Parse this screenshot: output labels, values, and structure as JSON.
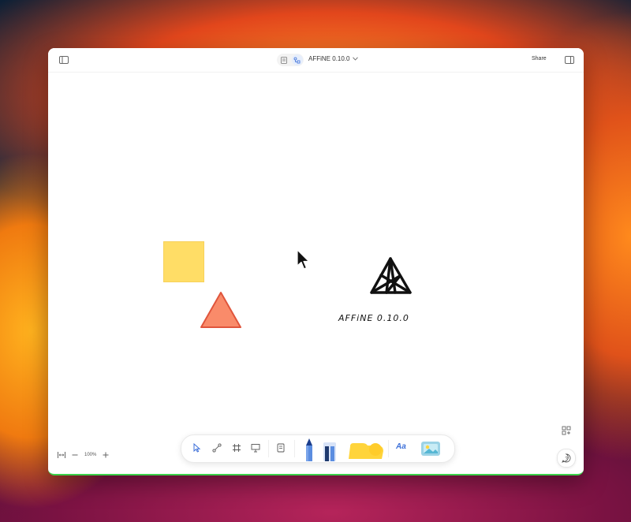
{
  "topbar": {
    "sidebar_toggle_icon": "sidebar-icon",
    "mode_page_icon": "page-mode-icon",
    "mode_edgeless_icon": "edgeless-mode-icon",
    "doc_title": "AFFiNE 0.10.0",
    "share_label": "Share",
    "right_panel_icon": "right-panel-icon"
  },
  "canvas": {
    "text_element": "AFFiNE 0.10.0",
    "colors": {
      "square": "#ffdd66",
      "triangle": "#f98b6a",
      "triangle_stroke": "#e0553c"
    }
  },
  "zoom": {
    "level": "100%"
  },
  "toolbar": {
    "tools": [
      "select-icon",
      "connector-icon",
      "frame-icon",
      "present-icon",
      "note-icon",
      "pen-icon",
      "highlighter-icon",
      "shape-icon",
      "text-icon",
      "media-icon"
    ],
    "text_tool_label": "Aa"
  },
  "side": {
    "add_icon": "add-template-icon",
    "help_icon": "help-icon"
  }
}
